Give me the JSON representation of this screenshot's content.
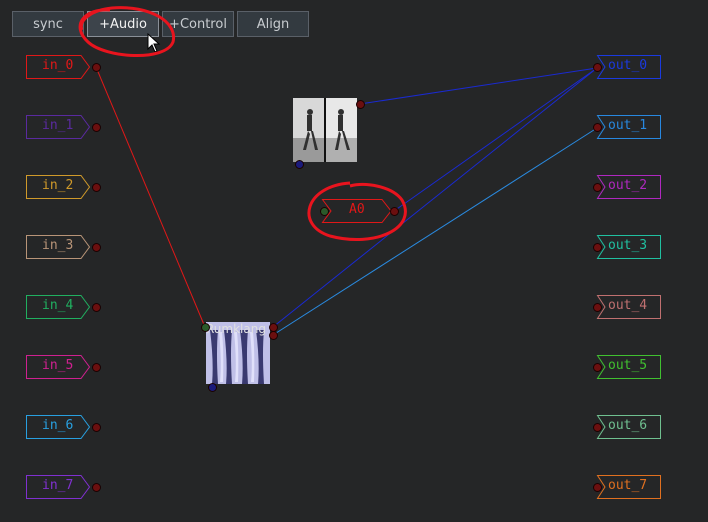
{
  "toolbar": {
    "sync": "sync",
    "add_audio": "+Audio",
    "add_control": "+Control",
    "align": "Align"
  },
  "inputs": [
    {
      "label": "in_0",
      "color": "#e01818"
    },
    {
      "label": "in_1",
      "color": "#5a2aa0"
    },
    {
      "label": "in_2",
      "color": "#d09a2a"
    },
    {
      "label": "in_3",
      "color": "#b89478"
    },
    {
      "label": "in_4",
      "color": "#20b060"
    },
    {
      "label": "in_5",
      "color": "#d02090"
    },
    {
      "label": "in_6",
      "color": "#28a0e0"
    },
    {
      "label": "in_7",
      "color": "#8030d0"
    }
  ],
  "outputs": [
    {
      "label": "out_0",
      "color": "#1a3ae0"
    },
    {
      "label": "out_1",
      "color": "#2888e0"
    },
    {
      "label": "out_2",
      "color": "#b028c0"
    },
    {
      "label": "out_3",
      "color": "#20c0a0"
    },
    {
      "label": "out_4",
      "color": "#c07070"
    },
    {
      "label": "out_5",
      "color": "#40c030"
    },
    {
      "label": "out_6",
      "color": "#70c090"
    },
    {
      "label": "out_7",
      "color": "#e07020"
    }
  ],
  "nodes": {
    "a0": {
      "label": "A0",
      "color": "#e01818"
    },
    "rumklang": {
      "label": "Rumklang"
    }
  },
  "colors": {
    "background": "#252627",
    "wire_red": "#e01818",
    "wire_blue": "#1a2ad0",
    "wire_lightblue": "#2a8ae0",
    "annotation": "#e8141e"
  }
}
